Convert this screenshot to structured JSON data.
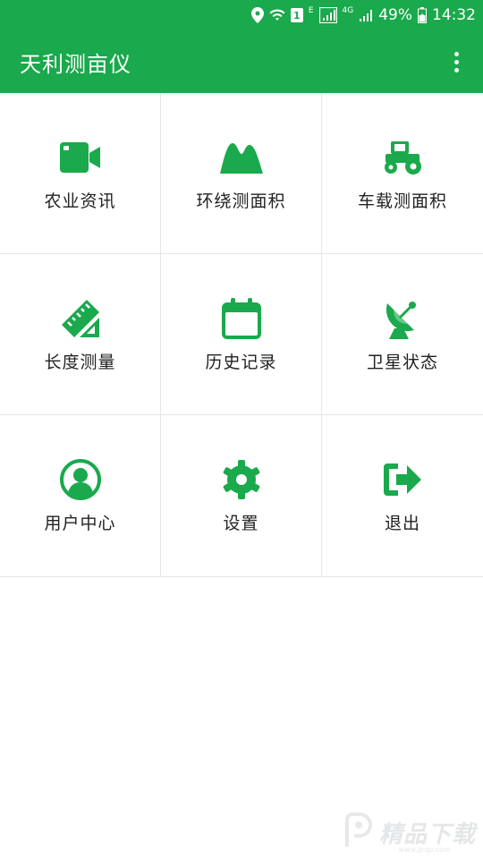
{
  "status_bar": {
    "sim_badge": "1",
    "lte_label": "E",
    "network_4g": "4G",
    "battery": "49%",
    "time": "14:32"
  },
  "app_bar": {
    "title": "天利测亩仪"
  },
  "colors": {
    "primary": "#1aa94c",
    "icon": "#1aa94c",
    "divider": "#e6e6e6",
    "text": "#222222"
  },
  "menu": [
    {
      "label": "农业资讯",
      "icon": "video-camera-icon"
    },
    {
      "label": "环绕测面积",
      "icon": "mountain-icon"
    },
    {
      "label": "车载测面积",
      "icon": "tractor-icon"
    },
    {
      "label": "长度测量",
      "icon": "ruler-icon"
    },
    {
      "label": "历史记录",
      "icon": "calendar-icon"
    },
    {
      "label": "卫星状态",
      "icon": "satellite-dish-icon"
    },
    {
      "label": "用户中心",
      "icon": "user-icon"
    },
    {
      "label": "设置",
      "icon": "gear-icon"
    },
    {
      "label": "退出",
      "icon": "logout-icon"
    }
  ],
  "watermark": {
    "text": "精品下载",
    "url": "www.jpqp.com"
  }
}
